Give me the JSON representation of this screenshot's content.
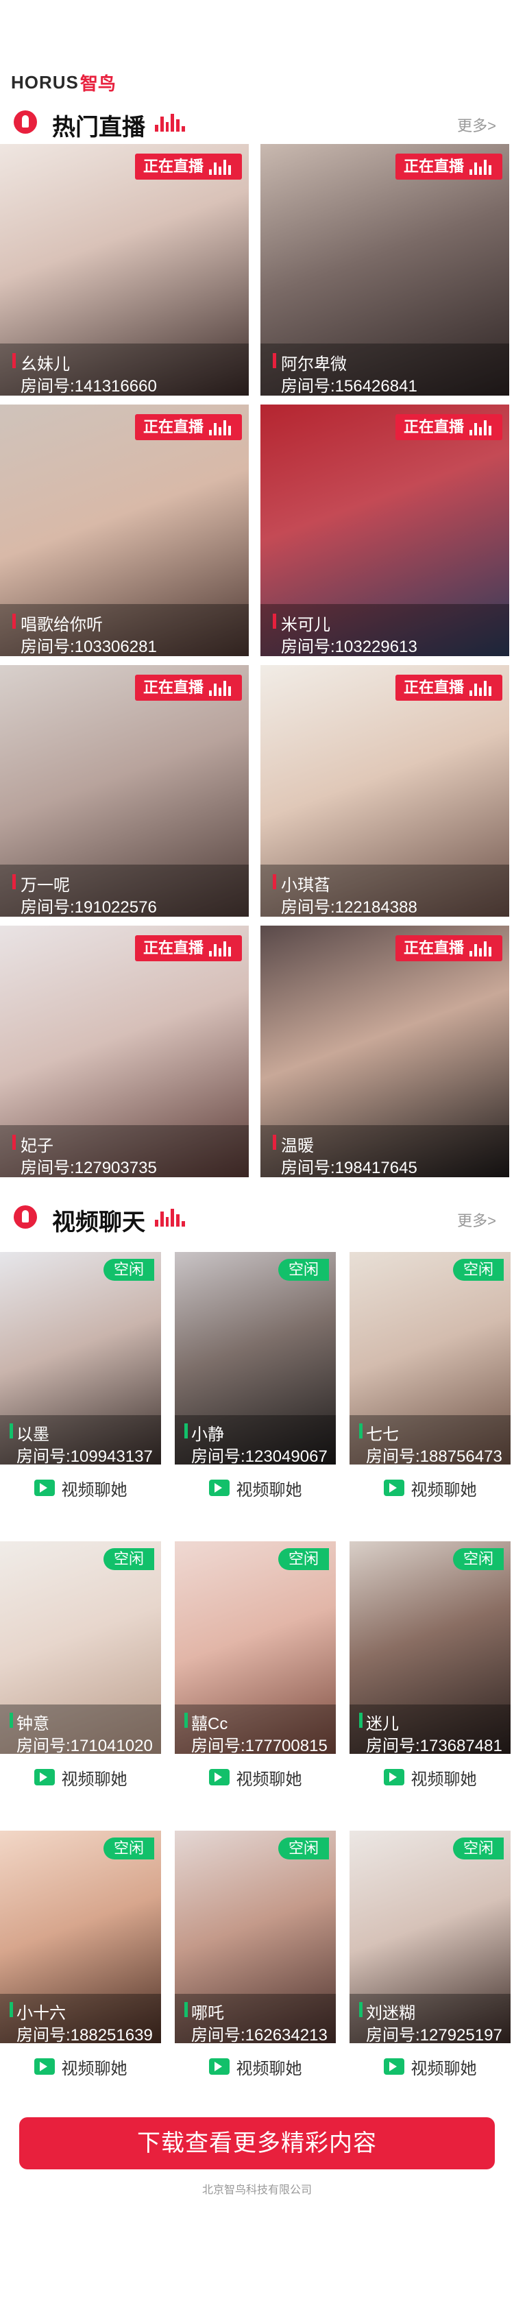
{
  "logo": {
    "text": "HORUS",
    "cn": "智鸟"
  },
  "hot_live": {
    "title": "热门直播",
    "more": "更多>",
    "live_label": "正在直播",
    "items": [
      {
        "name": "幺妹儿",
        "room": "房间号:141316660"
      },
      {
        "name": "阿尔卑微",
        "room": "房间号:156426841"
      },
      {
        "name": "唱歌给你听",
        "room": "房间号:103306281"
      },
      {
        "name": "米可儿",
        "room": "房间号:103229613"
      },
      {
        "name": "万一呢",
        "room": "房间号:191022576"
      },
      {
        "name": "小琪萏",
        "room": "房间号:122184388"
      },
      {
        "name": "妃子",
        "room": "房间号:127903735"
      },
      {
        "name": "温暖",
        "room": "房间号:198417645"
      }
    ]
  },
  "video_chat": {
    "title": "视频聊天",
    "more": "更多>",
    "free_label": "空闲",
    "chat_label": "视频聊她",
    "items": [
      {
        "name": "以墨",
        "room": "房间号:109943137"
      },
      {
        "name": "小静",
        "room": "房间号:123049067"
      },
      {
        "name": "七七",
        "room": "房间号:188756473"
      },
      {
        "name": "钟意",
        "room": "房间号:171041020"
      },
      {
        "name": "囍Cc",
        "room": "房间号:177700815"
      },
      {
        "name": "迷儿",
        "room": "房间号:173687481"
      },
      {
        "name": "小十六",
        "room": "房间号:188251639"
      },
      {
        "name": "哪吒",
        "room": "房间号:162634213"
      },
      {
        "name": "刘迷糊",
        "room": "房间号:127925197"
      }
    ]
  },
  "cta": {
    "label": "下载查看更多精彩内容"
  },
  "footer": {
    "text": "北京智鸟科技有限公司"
  },
  "colors": {
    "accent": "#e8203d",
    "free": "#12c06a"
  }
}
